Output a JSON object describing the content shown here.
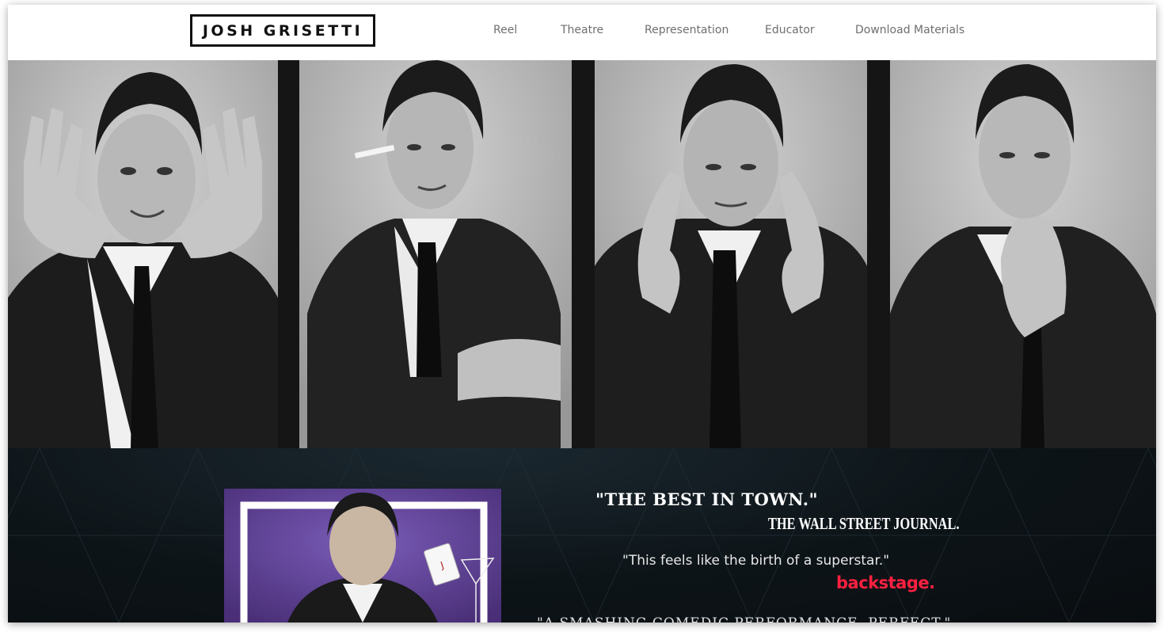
{
  "site": {
    "logo_text": "JOSH GRISETTI"
  },
  "nav": {
    "items": [
      {
        "label": "Reel",
        "name": "nav-reel"
      },
      {
        "label": "Theatre",
        "name": "nav-theatre"
      },
      {
        "label": "Representation",
        "name": "nav-representation"
      },
      {
        "label": "Educator",
        "name": "nav-educator"
      },
      {
        "label": "Download Materials",
        "name": "nav-download-materials"
      }
    ]
  },
  "quotes": [
    {
      "text": "\"THE BEST IN TOWN.\"",
      "source": "THE WALL STREET JOURNAL."
    },
    {
      "text": "\"This feels like the birth of a superstar.\"",
      "source": "backstage."
    },
    {
      "text": "\"A SMASHING COMEDIC PERFORMANCE. PERFECT.\"",
      "source": ""
    }
  ],
  "colors": {
    "accent_backstage": "#ff2040",
    "promo_purple": "#5a3f8e",
    "dark_section": "#0d1418"
  }
}
